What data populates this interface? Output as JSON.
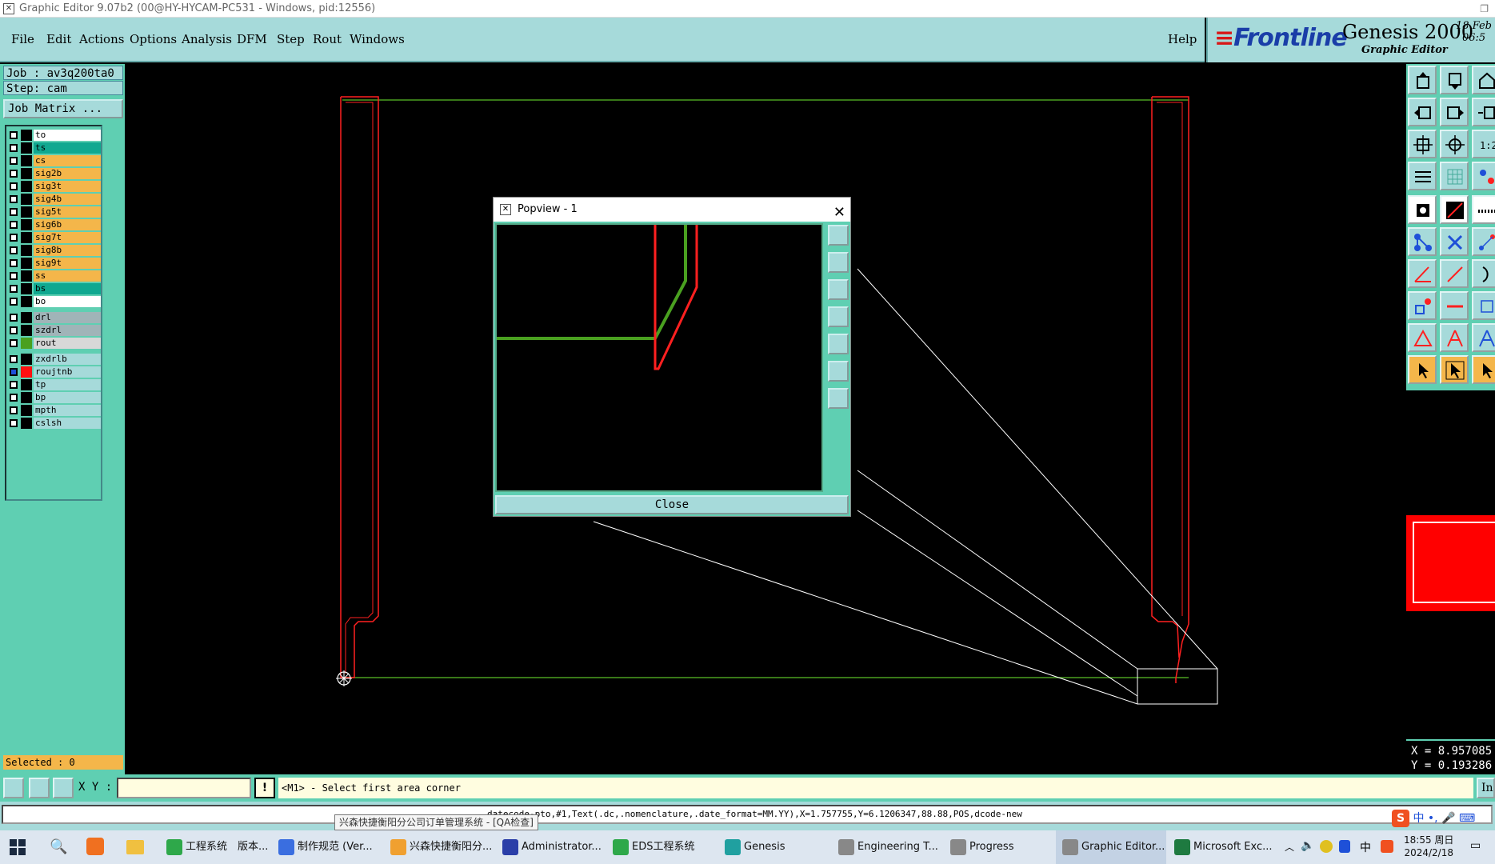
{
  "window": {
    "title": "Graphic Editor 9.07b2 (00@HY-HYCAM-PC531 - Windows, pid:12556)"
  },
  "menubar": {
    "items": [
      "File",
      "Edit",
      "Actions",
      "Options",
      "Analysis",
      "DFM",
      "Step",
      "Rout",
      "Windows"
    ],
    "help": "Help"
  },
  "brand": {
    "logo": "Frontline",
    "product": "Genesis 2000",
    "subtitle": "Graphic Editor",
    "date_line1": "18 Feb",
    "date_line2": "06:5"
  },
  "job": {
    "job_line": "Job : av3q200ta0",
    "step_line": "Step: cam",
    "matrix_button": "Job Matrix ..."
  },
  "layers": [
    {
      "name": "to",
      "color": "#ffffff",
      "swatch": "#000000",
      "group": 1
    },
    {
      "name": "ts",
      "color": "#10a890",
      "swatch": "#000000",
      "group": 1
    },
    {
      "name": "cs",
      "color": "#f4b64a",
      "swatch": "#000000",
      "group": 1
    },
    {
      "name": "sig2b",
      "color": "#f4b64a",
      "swatch": "#000000",
      "group": 1
    },
    {
      "name": "sig3t",
      "color": "#f4b64a",
      "swatch": "#000000",
      "group": 1
    },
    {
      "name": "sig4b",
      "color": "#f4b64a",
      "swatch": "#000000",
      "group": 1
    },
    {
      "name": "sig5t",
      "color": "#f4b64a",
      "swatch": "#000000",
      "group": 1
    },
    {
      "name": "sig6b",
      "color": "#f4b64a",
      "swatch": "#000000",
      "group": 1
    },
    {
      "name": "sig7t",
      "color": "#f4b64a",
      "swatch": "#000000",
      "group": 1
    },
    {
      "name": "sig8b",
      "color": "#f4b64a",
      "swatch": "#000000",
      "group": 1
    },
    {
      "name": "sig9t",
      "color": "#f4b64a",
      "swatch": "#000000",
      "group": 1
    },
    {
      "name": "ss",
      "color": "#f4b64a",
      "swatch": "#000000",
      "group": 1
    },
    {
      "name": "bs",
      "color": "#10a890",
      "swatch": "#000000",
      "group": 1
    },
    {
      "name": "bo",
      "color": "#ffffff",
      "swatch": "#000000",
      "group": 1
    },
    {
      "name": "drl",
      "color": "#a0b4b8",
      "swatch": "#000000",
      "group": 2
    },
    {
      "name": "szdrl",
      "color": "#a0b4b8",
      "swatch": "#000000",
      "group": 2
    },
    {
      "name": "rout",
      "color": "#d8d8d8",
      "swatch": "#4aa020",
      "group": 2
    },
    {
      "name": "zxdrlb",
      "color": "#a6dada",
      "swatch": "#000000",
      "group": 3
    },
    {
      "name": "roujtnb",
      "color": "#a6dada",
      "swatch": "#ff1010",
      "group": 3
    },
    {
      "name": "tp",
      "color": "#a6dada",
      "swatch": "#000000",
      "group": 3
    },
    {
      "name": "bp",
      "color": "#a6dada",
      "swatch": "#000000",
      "group": 3
    },
    {
      "name": "mpth",
      "color": "#a6dada",
      "swatch": "#000000",
      "group": 3
    },
    {
      "name": "cslsh",
      "color": "#a6dada",
      "swatch": "#000000",
      "group": 3
    }
  ],
  "selected_text": "Selected : 0",
  "popview": {
    "title": "Popview - 1",
    "close_button": "Close"
  },
  "coords": {
    "x": "X = 8.957085",
    "y": "Y = 0.193286"
  },
  "statusbar": {
    "xy_label": "X Y :",
    "xy_value": "",
    "info_button": "!",
    "prompt": "<M1> - Select first area corner",
    "right_button": "In"
  },
  "output_line": "datecode-pto,#1,Text(.dc,.nomenclature,.date_format=MM.YY),X=1.757755,Y=6.1206347,88.88,POS,dcode-new",
  "tooltip": "兴森快捷衡阳分公司订单管理系统 - [QA检查]",
  "taskbar": {
    "items": [
      {
        "label": "工程系统　版本...",
        "color": "#2ea84a"
      },
      {
        "label": "制作规范 (Ver...",
        "color": "#3a6ee0"
      },
      {
        "label": "兴森快捷衡阳分...",
        "color": "#f0a030"
      },
      {
        "label": "Administrator...",
        "color": "#2a3ea8"
      },
      {
        "label": "EDS工程系统",
        "color": "#2ea84a"
      },
      {
        "label": "Genesis",
        "color": "#20a0a0"
      },
      {
        "label": "Engineering T...",
        "color": "#888888"
      },
      {
        "label": "Progress",
        "color": "#888888"
      },
      {
        "label": "Graphic Editor...",
        "color": "#888888"
      },
      {
        "label": "Microsoft Exc...",
        "color": "#1e7a40"
      }
    ],
    "active_index": 8,
    "tray_input": "中",
    "time": "18:55 周日",
    "date": "2024/2/18"
  },
  "colors": {
    "panel_teal": "#5fcfb2",
    "button_cyan": "#a6dada",
    "profile_red": "#ff2020",
    "rout_green": "#4aa020"
  }
}
